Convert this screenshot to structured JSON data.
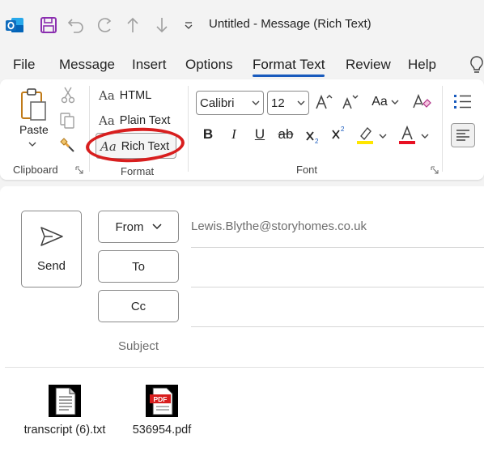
{
  "window": {
    "title": "Untitled  -  Message (Rich Text)"
  },
  "quick_access": {
    "icons": [
      "outlook-logo",
      "save-icon",
      "undo-icon",
      "redo-icon",
      "up-arrow-icon",
      "down-arrow-icon",
      "customize-qat-icon"
    ]
  },
  "tabs": [
    {
      "label": "File"
    },
    {
      "label": "Message"
    },
    {
      "label": "Insert"
    },
    {
      "label": "Options"
    },
    {
      "label": "Format Text",
      "active": true
    },
    {
      "label": "Review"
    },
    {
      "label": "Help"
    }
  ],
  "ribbon": {
    "clipboard": {
      "group_label": "Clipboard",
      "paste_label": "Paste"
    },
    "format": {
      "group_label": "Format",
      "aa": "Aa",
      "html_label": "HTML",
      "plain_label": "Plain Text",
      "rich_label": "Rich Text",
      "selected": "Rich Text"
    },
    "font": {
      "group_label": "Font",
      "font_name": "Calibri",
      "font_size": "12",
      "change_case": "Aa",
      "bold": "B",
      "italic": "I",
      "underline": "U",
      "strike": "ab",
      "highlight_color": "#ffe600",
      "font_color": "#e81123"
    }
  },
  "compose": {
    "send_label": "Send",
    "from_label": "From",
    "from_address": "Lewis.Blythe@storyhomes.co.uk",
    "to_label": "To",
    "cc_label": "Cc",
    "subject_label": "Subject",
    "attachments": [
      {
        "name": "transcript (6).txt",
        "type": "txt"
      },
      {
        "name": "536954.pdf",
        "type": "pdf",
        "badge": "PDF"
      }
    ]
  },
  "colors": {
    "accent": "#185abd",
    "outlook_blue": "#0f6cbd",
    "save_purple": "#8b2fb0",
    "annotation_red": "#d81e1e"
  }
}
